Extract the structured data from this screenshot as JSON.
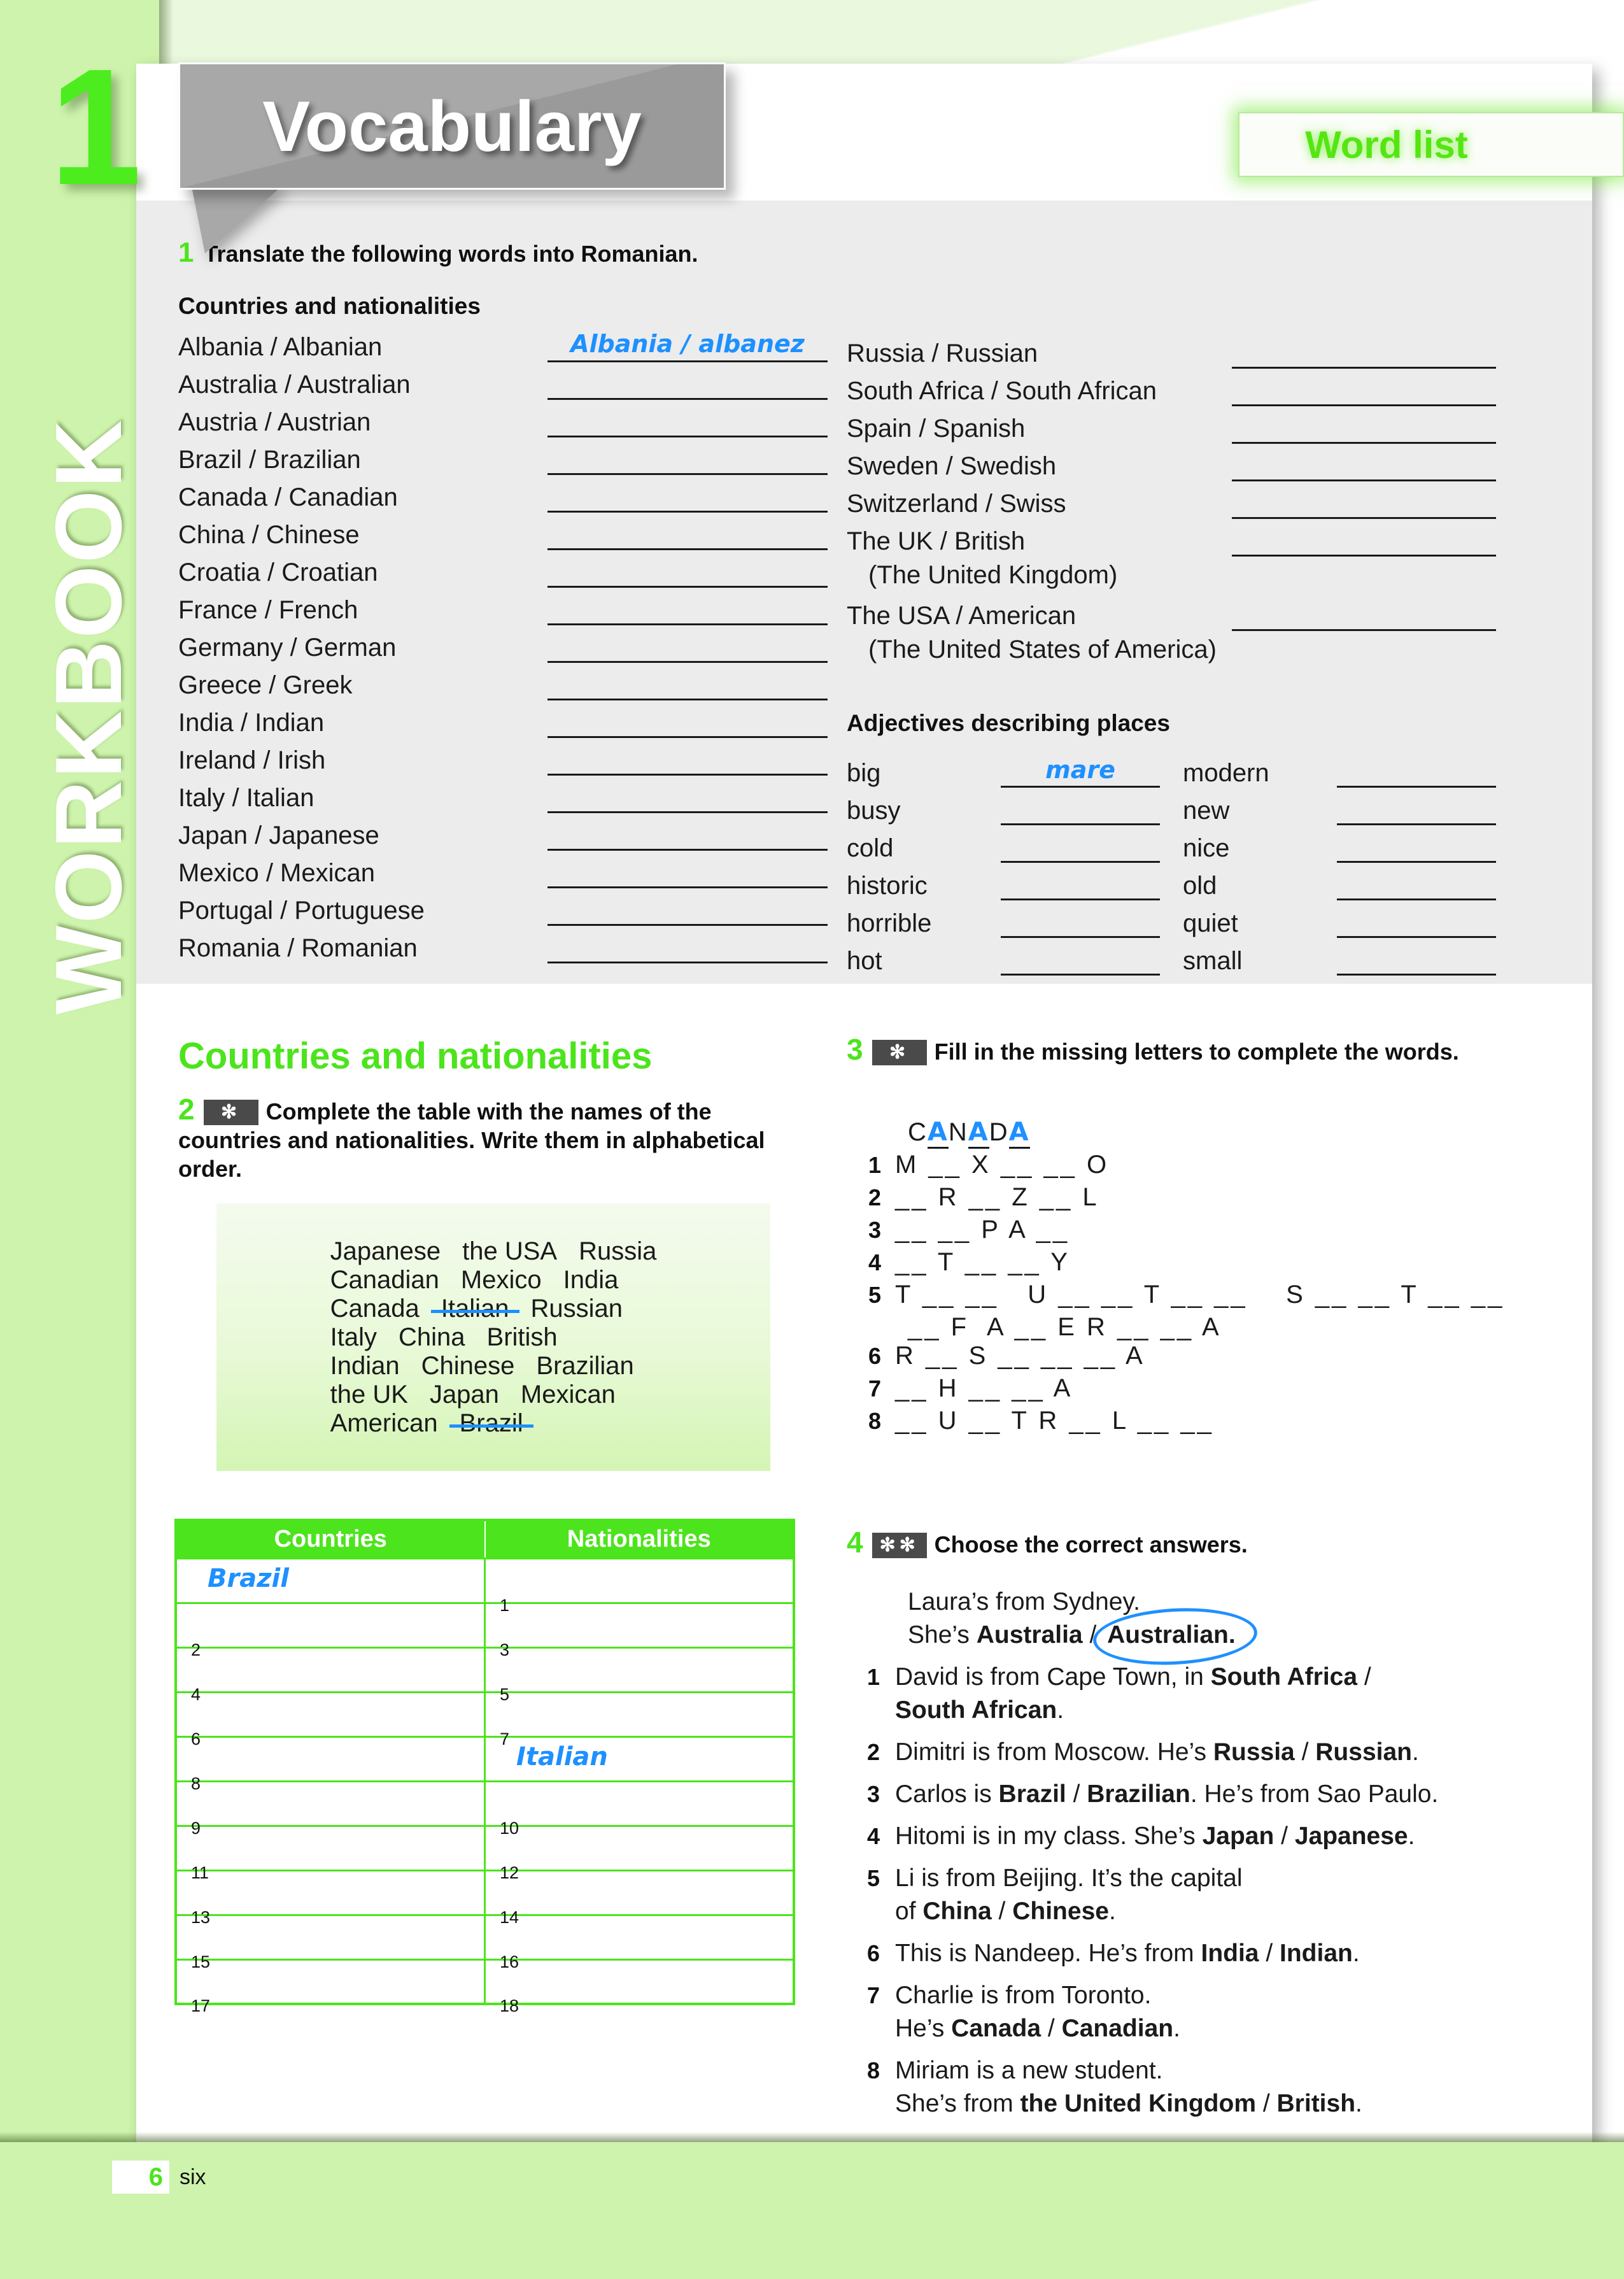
{
  "unit": {
    "number": "1",
    "title": "Vocabulary"
  },
  "sidebar": {
    "label": "WORKBOOK"
  },
  "header": {
    "word_list_label": "Word list"
  },
  "ex1": {
    "number": "1",
    "instruction": "Translate the following words into Romanian.",
    "subhead_countries": "Countries and nationalities",
    "left_items": [
      {
        "term": "Albania / Albanian",
        "answer": "Albania / albanez"
      },
      {
        "term": "Australia / Australian",
        "answer": ""
      },
      {
        "term": "Austria / Austrian",
        "answer": ""
      },
      {
        "term": "Brazil / Brazilian",
        "answer": ""
      },
      {
        "term": "Canada / Canadian",
        "answer": ""
      },
      {
        "term": "China / Chinese",
        "answer": ""
      },
      {
        "term": "Croatia / Croatian",
        "answer": ""
      },
      {
        "term": "France / French",
        "answer": ""
      },
      {
        "term": "Germany / German",
        "answer": ""
      },
      {
        "term": "Greece / Greek",
        "answer": ""
      },
      {
        "term": "India / Indian",
        "answer": ""
      },
      {
        "term": "Ireland / Irish",
        "answer": ""
      },
      {
        "term": "Italy / Italian",
        "answer": ""
      },
      {
        "term": "Japan / Japanese",
        "answer": ""
      },
      {
        "term": "Mexico / Mexican",
        "answer": ""
      },
      {
        "term": "Portugal / Portuguese",
        "answer": ""
      },
      {
        "term": "Romania / Romanian",
        "answer": ""
      }
    ],
    "right_items": [
      {
        "term": "Russia / Russian",
        "answer": ""
      },
      {
        "term": "South Africa / South African",
        "answer": ""
      },
      {
        "term": "Spain / Spanish",
        "answer": ""
      },
      {
        "term": "Sweden / Swedish",
        "answer": ""
      },
      {
        "term": "Switzerland / Swiss",
        "answer": ""
      },
      {
        "term": "The UK / British",
        "answer": ""
      }
    ],
    "uk_note": "(The United Kingdom)",
    "usa_item": {
      "term": "The USA / American",
      "answer": ""
    },
    "usa_note": "(The United States of America)",
    "subhead_adjectives": "Adjectives describing places",
    "adjectives_left": [
      {
        "label": "big",
        "answer": "mare"
      },
      {
        "label": "busy",
        "answer": ""
      },
      {
        "label": "cold",
        "answer": ""
      },
      {
        "label": "historic",
        "answer": ""
      },
      {
        "label": "horrible",
        "answer": ""
      },
      {
        "label": "hot",
        "answer": ""
      }
    ],
    "adjectives_right": [
      {
        "label": "modern",
        "answer": ""
      },
      {
        "label": "new",
        "answer": ""
      },
      {
        "label": "nice",
        "answer": ""
      },
      {
        "label": "old",
        "answer": ""
      },
      {
        "label": "quiet",
        "answer": ""
      },
      {
        "label": "small",
        "answer": ""
      }
    ]
  },
  "section_title": "Countries and nationalities",
  "ex2": {
    "number": "2",
    "difficulty": "✻",
    "instruction": "Complete the table with the names of the countries and nationalities. Write them in alphabetical order.",
    "wordbox_lines": [
      [
        {
          "w": "Japanese",
          "struck": false
        },
        {
          "w": "the USA",
          "struck": false
        },
        {
          "w": "Russia",
          "struck": false
        }
      ],
      [
        {
          "w": "Canadian",
          "struck": false
        },
        {
          "w": "Mexico",
          "struck": false
        },
        {
          "w": "India",
          "struck": false
        }
      ],
      [
        {
          "w": "Canada",
          "struck": false
        },
        {
          "w": "Italian",
          "struck": true
        },
        {
          "w": "Russian",
          "struck": false
        }
      ],
      [
        {
          "w": "Italy",
          "struck": false
        },
        {
          "w": "China",
          "struck": false
        },
        {
          "w": "British",
          "struck": false
        }
      ],
      [
        {
          "w": "Indian",
          "struck": false
        },
        {
          "w": "Chinese",
          "struck": false
        },
        {
          "w": "Brazilian",
          "struck": false
        }
      ],
      [
        {
          "w": "the UK",
          "struck": false
        },
        {
          "w": "Japan",
          "struck": false
        },
        {
          "w": "Mexican",
          "struck": false
        }
      ],
      [
        {
          "w": "American",
          "struck": false
        },
        {
          "w": "Brazil",
          "struck": true
        }
      ]
    ],
    "table_headers": [
      "Countries",
      "Nationalities"
    ],
    "table_rows": [
      [
        {
          "n": "",
          "answer": "Brazil"
        },
        {
          "n": "1",
          "answer": ""
        }
      ],
      [
        {
          "n": "2",
          "answer": ""
        },
        {
          "n": "3",
          "answer": ""
        }
      ],
      [
        {
          "n": "4",
          "answer": ""
        },
        {
          "n": "5",
          "answer": ""
        }
      ],
      [
        {
          "n": "6",
          "answer": ""
        },
        {
          "n": "7",
          "answer": ""
        }
      ],
      [
        {
          "n": "8",
          "answer": ""
        },
        {
          "n": "",
          "answer": "Italian"
        }
      ],
      [
        {
          "n": "9",
          "answer": ""
        },
        {
          "n": "10",
          "answer": ""
        }
      ],
      [
        {
          "n": "11",
          "answer": ""
        },
        {
          "n": "12",
          "answer": ""
        }
      ],
      [
        {
          "n": "13",
          "answer": ""
        },
        {
          "n": "14",
          "answer": ""
        }
      ],
      [
        {
          "n": "15",
          "answer": ""
        },
        {
          "n": "16",
          "answer": ""
        }
      ],
      [
        {
          "n": "17",
          "answer": ""
        },
        {
          "n": "18",
          "answer": ""
        }
      ]
    ]
  },
  "ex3": {
    "number": "3",
    "difficulty": "✻",
    "instruction": "Fill in the missing letters to complete the words.",
    "example": {
      "prefix": "C",
      "parts": [
        "A",
        "N",
        "A",
        "D",
        "A"
      ]
    },
    "items": [
      {
        "n": "1",
        "pattern": "M __ X __ __ O"
      },
      {
        "n": "2",
        "pattern": "__ R __ Z __ L"
      },
      {
        "n": "3",
        "pattern": "__ __ P A __"
      },
      {
        "n": "4",
        "pattern": "__ T __ __ Y"
      },
      {
        "n": "5",
        "pattern": "T __ __   U __ __ T __ __    S __ __ T __ __",
        "cont": "__ F  A __ E R __ __ A"
      },
      {
        "n": "6",
        "pattern": "R __ S __ __ __ A"
      },
      {
        "n": "7",
        "pattern": "__ H __ __ A"
      },
      {
        "n": "8",
        "pattern": "__ U __ T R __ L __ __"
      }
    ]
  },
  "ex4": {
    "number": "4",
    "difficulty": "✻✻",
    "instruction": "Choose the correct answers.",
    "example": {
      "line1": "Laura’s from Sydney.",
      "line2_pre": "She’s ",
      "opt_a": "Australia",
      "sep": " / ",
      "opt_b": "Australian."
    },
    "items": [
      {
        "n": "1",
        "html": "David is from Cape Town, in <b>South Africa</b> /<br><b>South African</b>."
      },
      {
        "n": "2",
        "html": "Dimitri is from Moscow. He’s <b>Russia</b> / <b>Russian</b>."
      },
      {
        "n": "3",
        "html": "Carlos is <b>Brazil</b> / <b>Brazilian</b>. He’s from Sao Paulo."
      },
      {
        "n": "4",
        "html": "Hitomi is in my class. She’s <b>Japan</b> / <b>Japanese</b>."
      },
      {
        "n": "5",
        "html": "Li is from Beijing. It’s the capital<br>of <b>China</b> / <b>Chinese</b>."
      },
      {
        "n": "6",
        "html": "This is Nandeep. He’s from <b>India</b> / <b>Indian</b>."
      },
      {
        "n": "7",
        "html": "Charlie is from Toronto.<br>He’s <b>Canada</b> / <b>Canadian</b>."
      },
      {
        "n": "8",
        "html": "Miriam is a new student.<br>She’s from <b>the United Kingdom</b> / <b>British</b>."
      }
    ]
  },
  "footer": {
    "page_number": "6",
    "page_word": "six"
  },
  "colors": {
    "accent_green": "#4ce41c",
    "ink_blue": "#1e90ff",
    "band_green": "#cdf3ac",
    "panel_grey": "#ececec",
    "badge_grey": "#4a4a4a"
  }
}
